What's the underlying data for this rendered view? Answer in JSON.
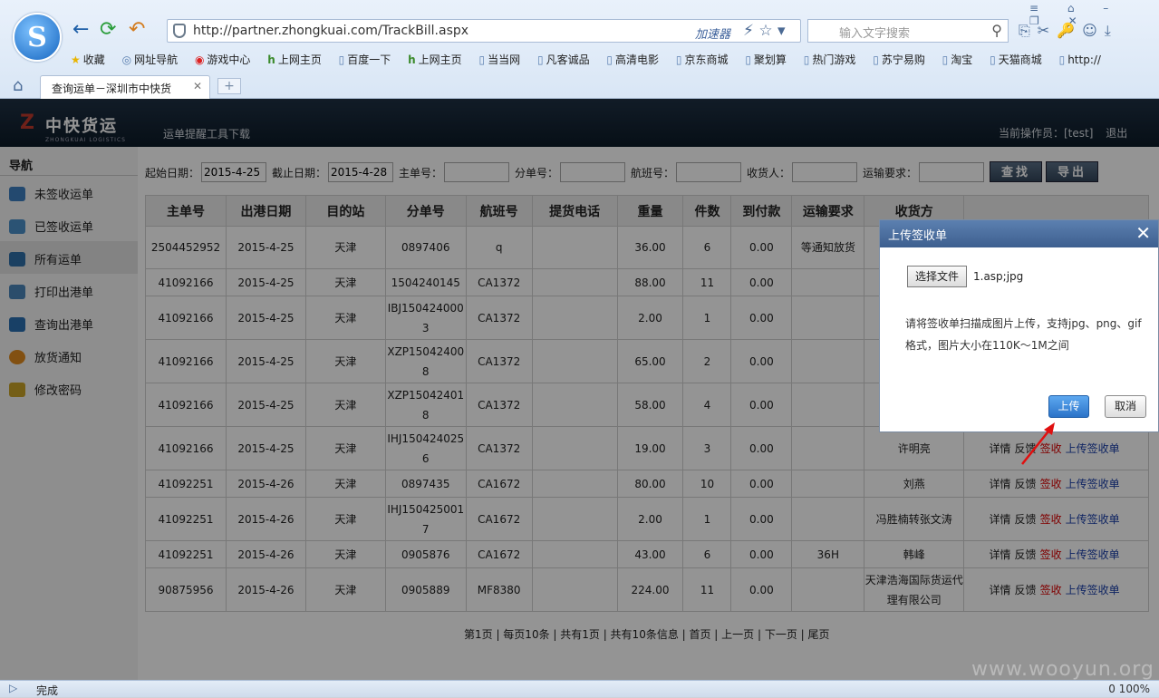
{
  "browser": {
    "url": "http://partner.zhongkuai.com/TrackBill.aspx",
    "accelerator": "加速器",
    "search_placeholder": "输入文字搜索",
    "tab_title": "查询运单－深圳市中快货",
    "favorites": [
      "收藏",
      "网址导航",
      "游戏中心",
      "上网主页",
      "百度一下",
      "上网主页",
      "当当网",
      "凡客诚品",
      "高清电影",
      "京东商城",
      "聚划算",
      "热门游戏",
      "苏宁易购",
      "淘宝",
      "天猫商城",
      "http://"
    ],
    "status": "完成",
    "status_right": "0  100%"
  },
  "site": {
    "logo_text": "中快货运",
    "logo_sub": "ZHONGKUAI LOGISTICS",
    "tool_download": "运单提醒工具下载",
    "operator": "当前操作员：[test]",
    "logout": "退出"
  },
  "sidebar": {
    "heading": "导航",
    "items": [
      {
        "label": "未签收运单",
        "color": "#3d7fc0"
      },
      {
        "label": "已签收运单",
        "color": "#4a8fc9"
      },
      {
        "label": "所有运单",
        "color": "#2f6fa8"
      },
      {
        "label": "打印出港单",
        "color": "#4b86b8"
      },
      {
        "label": "查询出港单",
        "color": "#2a6fb0"
      },
      {
        "label": "放货通知",
        "color": "#e08a1e"
      },
      {
        "label": "修改密码",
        "color": "#c9a227"
      }
    ]
  },
  "filters": {
    "start_label": "起始日期：",
    "start_value": "2015-4-25",
    "end_label": "截止日期：",
    "end_value": "2015-4-28",
    "main_no_label": "主单号：",
    "sub_no_label": "分单号：",
    "flight_label": "航班号：",
    "receiver_label": "收货人：",
    "req_label": "运输要求：",
    "search_btn": "查找",
    "export_btn": "导出"
  },
  "table": {
    "headers": [
      "主单号",
      "出港日期",
      "目的站",
      "分单号",
      "航班号",
      "提货电话",
      "重量",
      "件数",
      "到付款",
      "运输要求",
      "收货方",
      ""
    ],
    "rows": [
      [
        "2504452952",
        "2015-4-25",
        "天津",
        "0897406",
        "q",
        "",
        "36.00",
        "6",
        "0.00",
        "等通知放货",
        "",
        ""
      ],
      [
        "41092166",
        "2015-4-25",
        "天津",
        "1504240145",
        "CA1372",
        "",
        "88.00",
        "11",
        "0.00",
        "",
        "",
        ""
      ],
      [
        "41092166",
        "2015-4-25",
        "天津",
        "IBJ1504240003",
        "CA1372",
        "",
        "2.00",
        "1",
        "0.00",
        "",
        "",
        ""
      ],
      [
        "41092166",
        "2015-4-25",
        "天津",
        "XZP150424008",
        "CA1372",
        "",
        "65.00",
        "2",
        "0.00",
        "",
        "",
        ""
      ],
      [
        "41092166",
        "2015-4-25",
        "天津",
        "XZP150424018",
        "CA1372",
        "",
        "58.00",
        "4",
        "0.00",
        "",
        "",
        ""
      ],
      [
        "41092166",
        "2015-4-25",
        "天津",
        "IHJ1504240256",
        "CA1372",
        "",
        "19.00",
        "3",
        "0.00",
        "",
        "许明亮",
        "ops"
      ],
      [
        "41092251",
        "2015-4-26",
        "天津",
        "0897435",
        "CA1672",
        "",
        "80.00",
        "10",
        "0.00",
        "",
        "刘燕",
        "ops"
      ],
      [
        "41092251",
        "2015-4-26",
        "天津",
        "IHJ1504250017",
        "CA1672",
        "",
        "2.00",
        "1",
        "0.00",
        "",
        "冯胜楠转张文涛",
        "ops"
      ],
      [
        "41092251",
        "2015-4-26",
        "天津",
        "0905876",
        "CA1672",
        "",
        "43.00",
        "6",
        "0.00",
        "36H",
        "韩峰",
        "ops"
      ],
      [
        "90875956",
        "2015-4-26",
        "天津",
        "0905889",
        "MF8380",
        "",
        "224.00",
        "11",
        "0.00",
        "",
        "天津浩海国际货运代理有限公司",
        "ops"
      ]
    ],
    "ops": {
      "detail": "详情",
      "feedback": "反馈",
      "sign": "签收",
      "upload": "上传签收单"
    }
  },
  "pager": "第1页 | 每页10条 | 共有1页 | 共有10条信息 | 首页 | 上一页 | 下一页 | 尾页",
  "dialog": {
    "title": "上传签收单",
    "choose_btn": "选择文件",
    "file_name": "1.asp;jpg",
    "hint": "请将签收单扫描成图片上传，支持jpg、png、gif格式，图片大小在110K～1M之间",
    "upload_btn": "上传",
    "cancel_btn": "取消"
  },
  "watermark": "www.wooyun.org"
}
